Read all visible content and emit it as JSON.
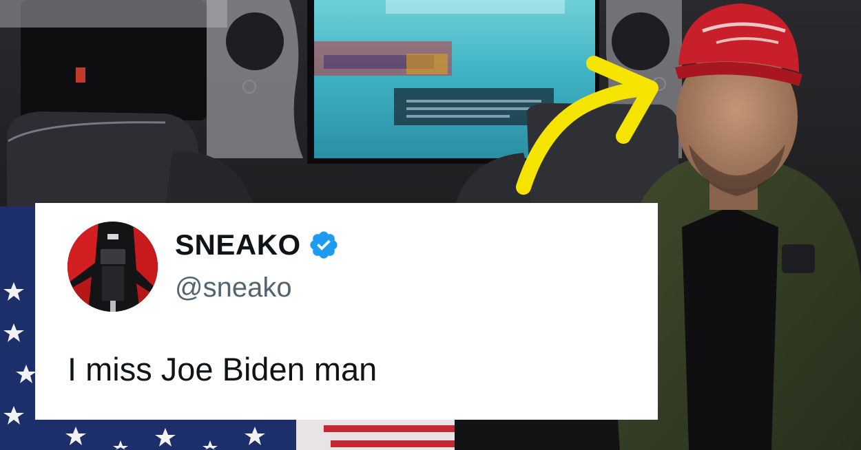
{
  "tweet": {
    "display_name": "SNEAKO",
    "handle": "@sneako",
    "text": "I miss Joe Biden man",
    "verified": true
  },
  "overlay": {
    "arrow_color": "#f5e400",
    "verified_color": "#1d9bf0"
  }
}
